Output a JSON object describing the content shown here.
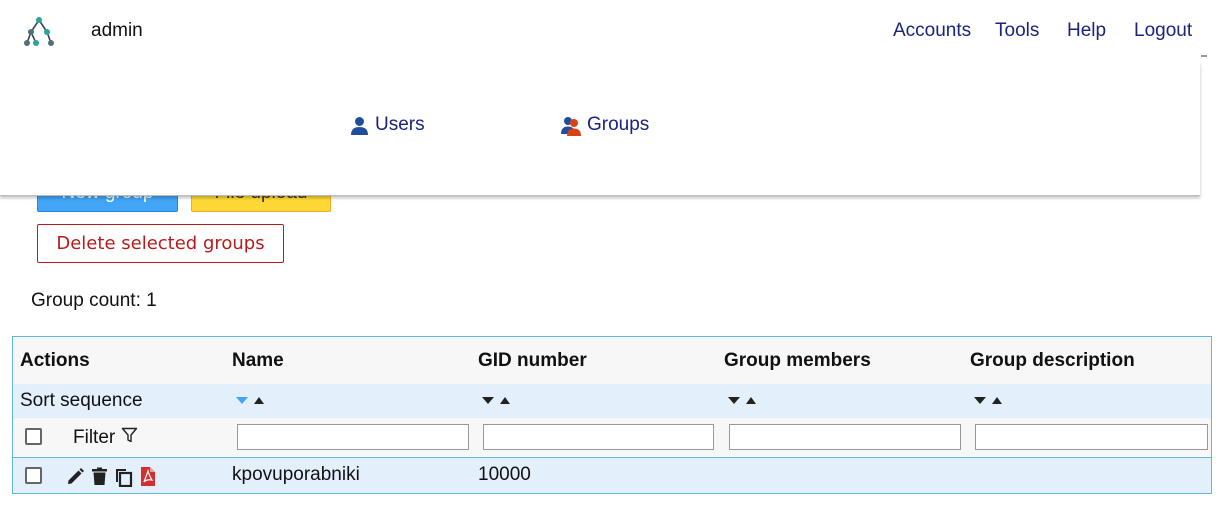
{
  "header": {
    "user": "admin",
    "nav": [
      "Accounts",
      "Tools",
      "Help",
      "Logout"
    ]
  },
  "subnav": {
    "users": "Users",
    "groups": "Groups"
  },
  "actions": {
    "new_group": "New group",
    "file_upload": "File upload",
    "delete_selected": "Delete selected groups"
  },
  "group_count": "Group count: 1",
  "table": {
    "columns": [
      "Actions",
      "Name",
      "GID number",
      "Group members",
      "Group description"
    ],
    "sort_label": "Sort sequence",
    "filter_label": "Filter",
    "rows": [
      {
        "name": "kpovuporabniki",
        "gid": "10000",
        "members": "",
        "description": ""
      }
    ]
  },
  "colors": {
    "link": "#1a237e",
    "new_button": "#42a5f5",
    "upload_button": "#fdd835",
    "delete_border": "#b71c1c",
    "table_border": "#5fb8e0",
    "row_highlight": "#e3f0fb"
  }
}
